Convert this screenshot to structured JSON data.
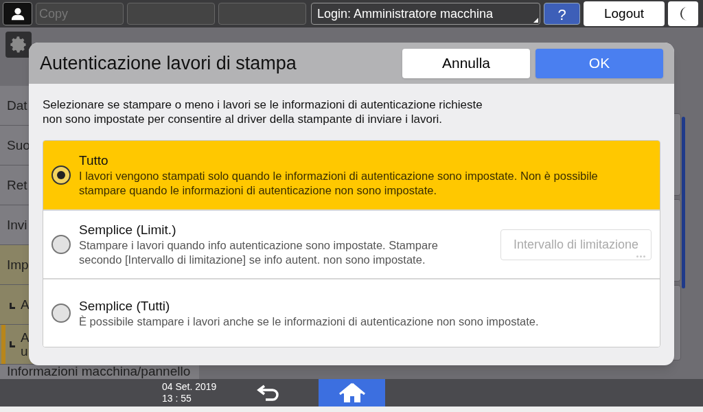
{
  "top_bar": {
    "app_tabs": [
      {
        "kind": "labeled",
        "label": "Copy"
      },
      {
        "kind": "empty"
      },
      {
        "kind": "empty"
      }
    ],
    "login": "Login: Amministratore macchina",
    "help": "?",
    "logout": "Logout"
  },
  "sidebar": {
    "items": [
      {
        "label": "Dat",
        "kind": "item",
        "highlighted": false,
        "selected": false
      },
      {
        "label": "Suo",
        "kind": "item",
        "highlighted": false,
        "selected": false
      },
      {
        "label": "Ret",
        "kind": "item",
        "highlighted": false,
        "selected": false
      },
      {
        "label": "Invi",
        "kind": "item",
        "highlighted": false,
        "selected": false
      },
      {
        "label": "Imp",
        "kind": "item",
        "highlighted": true,
        "selected": false
      },
      {
        "label": "A",
        "kind": "sub",
        "highlighted": true,
        "selected": false
      },
      {
        "label": "A\nu",
        "kind": "sub",
        "highlighted": true,
        "selected": true
      },
      {
        "label": "Informazioni macchina/pannello",
        "kind": "item",
        "highlighted": false,
        "selected": false
      }
    ]
  },
  "dialog": {
    "title": "Autenticazione lavori di stampa",
    "cancel": "Annulla",
    "ok": "OK",
    "description": "Selezionare se stampare o meno i lavori se le informazioni di autenticazione richieste\nnon sono impostate per consentire al driver della stampante di inviare i lavori.",
    "options": [
      {
        "title": "Tutto",
        "description": "I lavori vengono stampati solo quando le informazioni di autenticazione sono impostate. Non è possibile\nstampare quando le informazioni di autenticazione non sono impostate.",
        "selected": true
      },
      {
        "title": "Semplice (Limit.)",
        "description": "Stampare i lavori quando info autenticazione sono impostate. Stampare\nsecondo [Intervallo di limitazione] se info autent. non sono impostate.",
        "selected": false,
        "button": {
          "label": "Intervallo di limitazione",
          "disabled": true
        }
      },
      {
        "title": "Semplice (Tutti)",
        "description": "È possibile stampare i lavori anche se le informazioni di autenticazione non sono impostate.",
        "selected": false
      }
    ]
  },
  "bottom_bar": {
    "date": "04 Set. 2019",
    "time": "13 : 55"
  }
}
